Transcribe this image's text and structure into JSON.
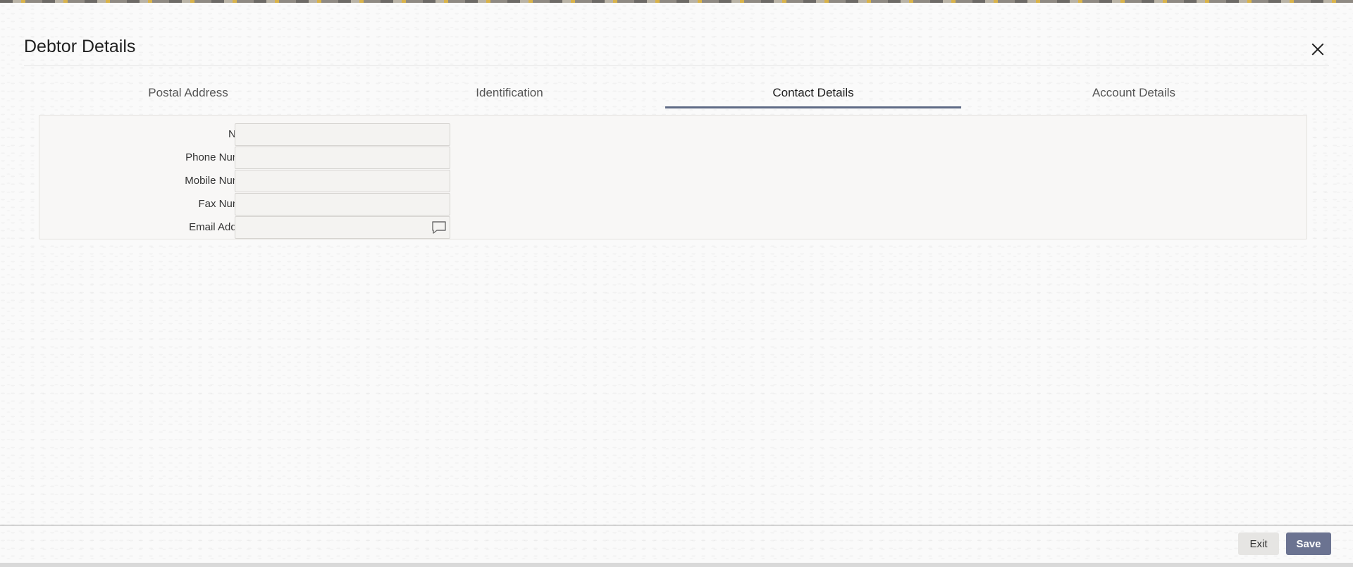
{
  "dialog": {
    "title": "Debtor Details",
    "close_icon": "close-icon"
  },
  "tabs": [
    {
      "label": "Postal Address",
      "active": false
    },
    {
      "label": "Identification",
      "active": false
    },
    {
      "label": "Contact Details",
      "active": true
    },
    {
      "label": "Account Details",
      "active": false
    }
  ],
  "contact_form": {
    "name": {
      "label": "Name",
      "value": ""
    },
    "phone": {
      "label": "Phone Number",
      "value": ""
    },
    "mobile": {
      "label": "Mobile Number",
      "value": ""
    },
    "fax": {
      "label": "Fax Number",
      "value": ""
    },
    "email": {
      "label": "Email Address",
      "value": "",
      "icon": "message-icon"
    }
  },
  "footer": {
    "exit_label": "Exit",
    "save_label": "Save"
  },
  "colors": {
    "accent": "#6b7391",
    "active_tab_underline": "#5f6b86"
  }
}
